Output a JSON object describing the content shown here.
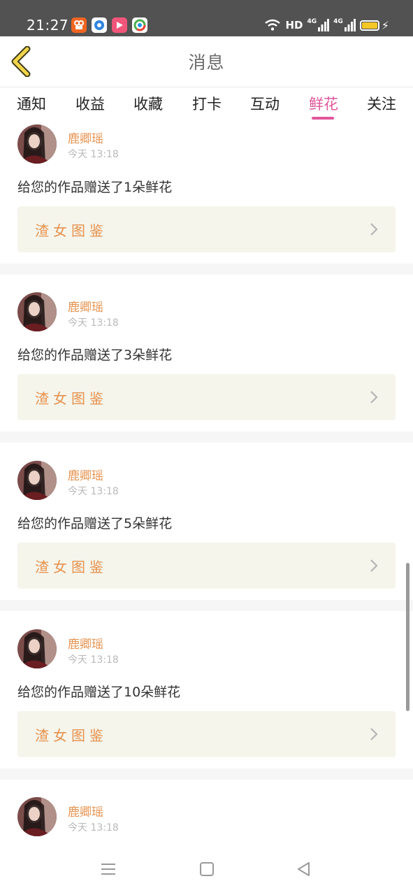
{
  "status_bar": {
    "time": "21:27",
    "hd_label": "HD",
    "net1": "4G",
    "net2": "4G",
    "battery_color": "#f4c726",
    "app_icons": [
      "kuaishou-app-icon",
      "circle-app-icon",
      "video-app-icon",
      "browser-app-icon"
    ]
  },
  "header": {
    "title": "消息",
    "back_icon": "chevron-left-icon"
  },
  "tabs": [
    {
      "label": "通知",
      "active": false
    },
    {
      "label": "收益",
      "active": false
    },
    {
      "label": "收藏",
      "active": false
    },
    {
      "label": "打卡",
      "active": false
    },
    {
      "label": "互动",
      "active": false
    },
    {
      "label": "鲜花",
      "active": true
    },
    {
      "label": "关注",
      "active": false
    }
  ],
  "colors": {
    "accent": "#e1579a",
    "sender": "#e7924e",
    "work_box_bg": "#f5f5ec"
  },
  "messages": [
    {
      "sender": "鹿卿瑶",
      "time": "今天 13:18",
      "text": "给您的作品赠送了1朵鲜花",
      "work_title": "渣女图鉴"
    },
    {
      "sender": "鹿卿瑶",
      "time": "今天 13:18",
      "text": "给您的作品赠送了3朵鲜花",
      "work_title": "渣女图鉴"
    },
    {
      "sender": "鹿卿瑶",
      "time": "今天 13:18",
      "text": "给您的作品赠送了5朵鲜花",
      "work_title": "渣女图鉴"
    },
    {
      "sender": "鹿卿瑶",
      "time": "今天 13:18",
      "text": "给您的作品赠送了10朵鲜花",
      "work_title": "渣女图鉴"
    },
    {
      "sender": "鹿卿瑶",
      "time": "今天 13:18"
    }
  ],
  "nav": {
    "menu_icon": "menu-icon",
    "home_icon": "square-home-icon",
    "back_icon": "triangle-back-icon"
  }
}
